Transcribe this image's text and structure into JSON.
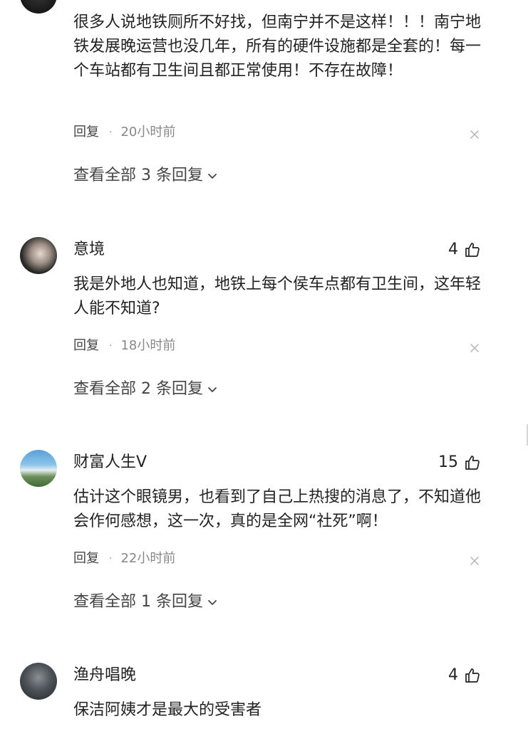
{
  "comments": [
    {
      "author": "",
      "likes": "",
      "text": "很多人说地铁厕所不好找，但南宁并不是这样！！！南宁地铁发展晚运营也没几年，所有的硬件设施都是全套的！每一个车站都有卫生间且都正常使用！不存在故障！",
      "reply_label": "回复",
      "separator": "·",
      "time": "20小时前",
      "more_replies": "查看全部 3 条回复"
    },
    {
      "author": "意境",
      "likes": "4",
      "text": "我是外地人也知道，地铁上每个侯车点都有卫生间，这年轻人能不知道?",
      "reply_label": "回复",
      "separator": "·",
      "time": "18小时前",
      "more_replies": "查看全部 2 条回复"
    },
    {
      "author": "财富人生V",
      "likes": "15",
      "text": "估计这个眼镜男，也看到了自己上热搜的消息了，不知道他会作何感想，这一次，真的是全网“社死”啊！",
      "reply_label": "回复",
      "separator": "·",
      "time": "22小时前",
      "more_replies": "查看全部 1 条回复"
    },
    {
      "author": "渔舟唱晚",
      "likes": "4",
      "text": "保洁阿姨才是最大的受害者"
    }
  ],
  "icons": {
    "like": "thumbs-up-icon",
    "close": "close-icon",
    "expand": "chevron-down-icon"
  },
  "colors": {
    "text": "#222222",
    "meta": "#888888",
    "icon": "#222222",
    "close": "#bbbbbb"
  }
}
